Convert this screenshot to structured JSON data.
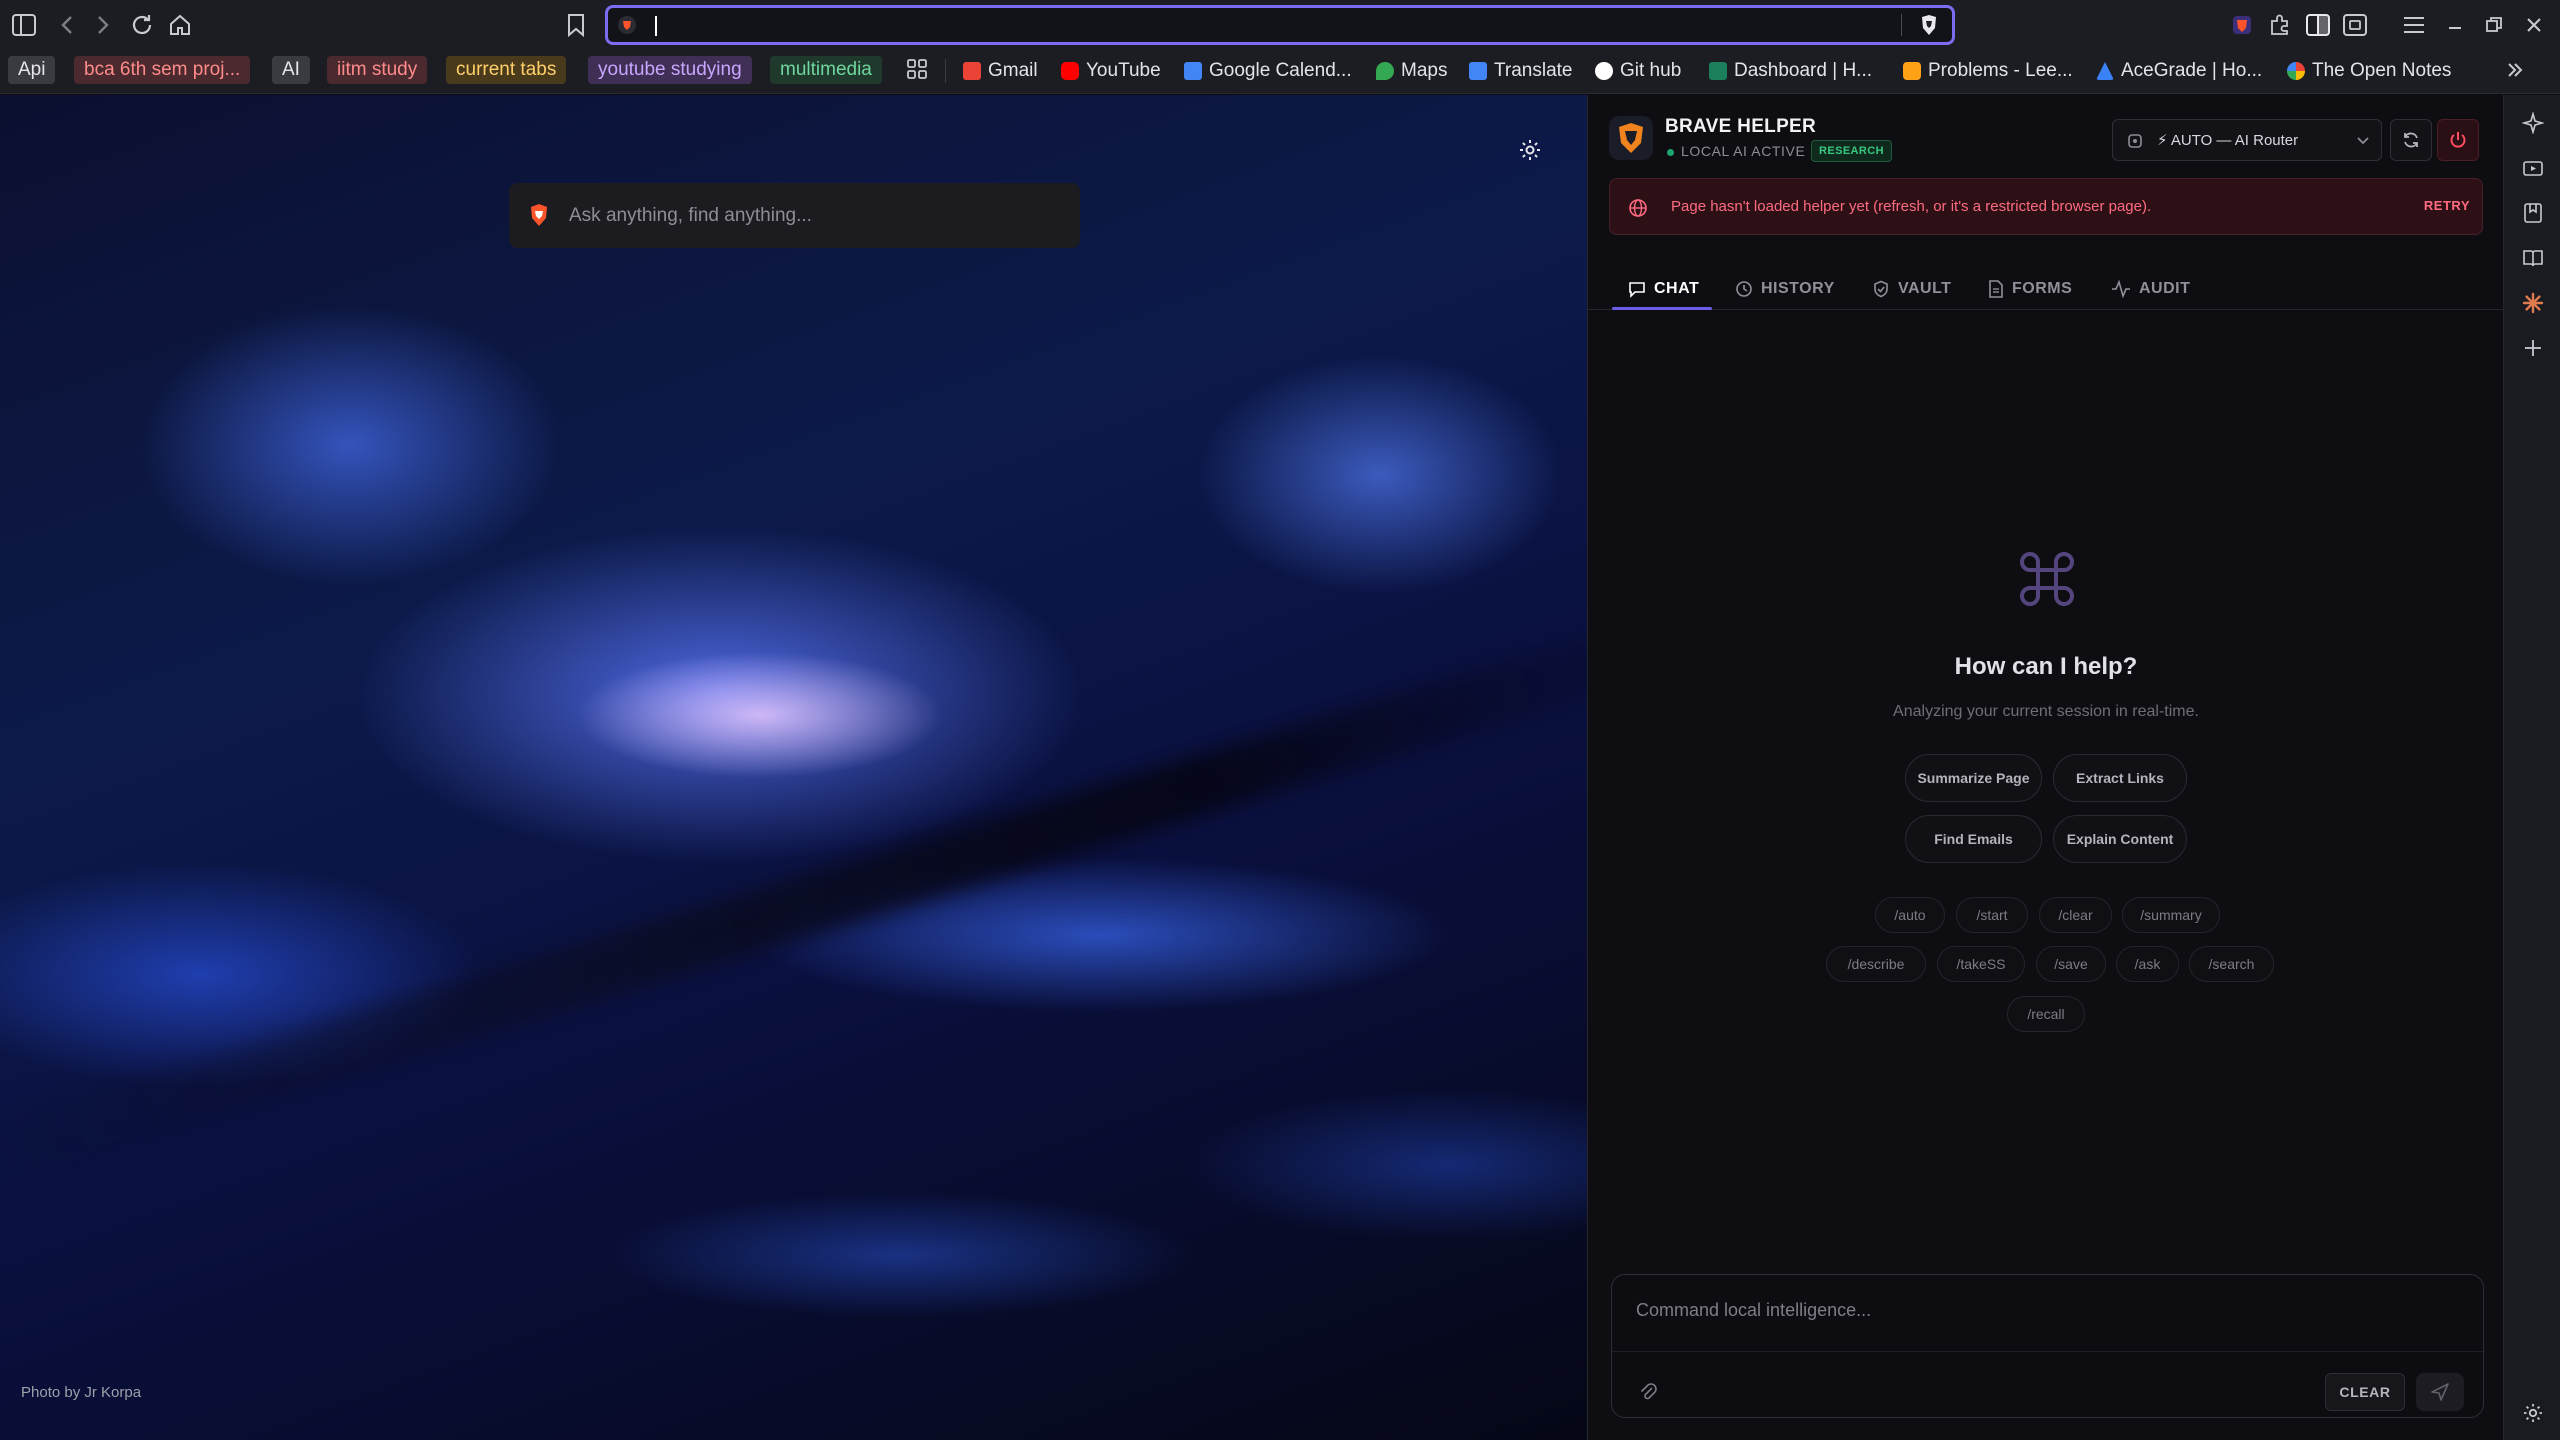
{
  "toolbar": {
    "url_value": "",
    "buttons": [
      "sidebar",
      "back",
      "forward",
      "reload",
      "home",
      "bookmark",
      "extensions",
      "split-view",
      "screenshot",
      "menu",
      "minimize",
      "maximize",
      "close"
    ]
  },
  "bookmarks": {
    "folders": [
      {
        "label": "Api",
        "color": "#3a3b41",
        "text_color": "#e6e6ea"
      },
      {
        "label": "bca 6th sem proj...",
        "color": "#4a2a2e",
        "text_color": "#ff8a8a"
      },
      {
        "label": "AI",
        "color": "#3a3b41",
        "text_color": "#e6e6ea"
      },
      {
        "label": "iitm study",
        "color": "#4a2a2e",
        "text_color": "#ff8a8a"
      },
      {
        "label": "current tabs",
        "color": "#4a3a1c",
        "text_color": "#ffcf6a"
      },
      {
        "label": "youtube studying",
        "color": "#3f2f55",
        "text_color": "#c8a6ff"
      },
      {
        "label": "multimedia",
        "color": "#1f3a2c",
        "text_color": "#6fd69e"
      }
    ],
    "links": [
      {
        "label": "Gmail",
        "icon": "gmail-icon",
        "color": "#ea4335"
      },
      {
        "label": "YouTube",
        "icon": "youtube-icon",
        "color": "#ff0000"
      },
      {
        "label": "Google Calend...",
        "icon": "calendar-icon",
        "color": "#4285f4"
      },
      {
        "label": "Maps",
        "icon": "maps-icon",
        "color": "#34a853"
      },
      {
        "label": "Translate",
        "icon": "translate-icon",
        "color": "#4285f4"
      },
      {
        "label": "Git hub",
        "icon": "github-icon",
        "color": "#ffffff"
      },
      {
        "label": "Dashboard | H...",
        "icon": "dashboard-icon",
        "color": "#1a7f5a"
      },
      {
        "label": "Problems - Lee...",
        "icon": "leetcode-icon",
        "color": "#ffa116"
      },
      {
        "label": "AceGrade | Ho...",
        "icon": "acegrade-icon",
        "color": "#3b82f6"
      },
      {
        "label": "The Open Notes",
        "icon": "google-icon",
        "color": "#fbbc05"
      }
    ]
  },
  "page": {
    "search_placeholder": "Ask anything, find anything...",
    "photo_credit": "Photo by Jr Korpa"
  },
  "helper": {
    "title": "BRAVE HELPER",
    "status": "LOCAL AI ACTIVE",
    "status_color": "#1ea672",
    "mode_badge": "RESEARCH",
    "router_label": "⚡ AUTO — AI Router",
    "error_message": "Page hasn't loaded helper yet (refresh, or it's a restricted browser page).",
    "retry_label": "RETRY",
    "tabs": [
      {
        "label": "CHAT",
        "icon": "chat-icon",
        "active": true
      },
      {
        "label": "HISTORY",
        "icon": "history-icon",
        "active": false
      },
      {
        "label": "VAULT",
        "icon": "shield-icon",
        "active": false
      },
      {
        "label": "FORMS",
        "icon": "document-icon",
        "active": false
      },
      {
        "label": "AUDIT",
        "icon": "pulse-icon",
        "active": false
      }
    ],
    "empty_state": {
      "title": "How can I help?",
      "subtitle": "Analyzing your current session in real-time."
    },
    "quick_actions": [
      "Summarize Page",
      "Extract Links",
      "Find Emails",
      "Explain Content"
    ],
    "commands": [
      "/auto",
      "/start",
      "/clear",
      "/summary",
      "/describe",
      "/takeSS",
      "/save",
      "/ask",
      "/search",
      "/recall"
    ],
    "composer_placeholder": "Command local intelligence...",
    "clear_label": "CLEAR",
    "accent": "#6b5ee8"
  }
}
